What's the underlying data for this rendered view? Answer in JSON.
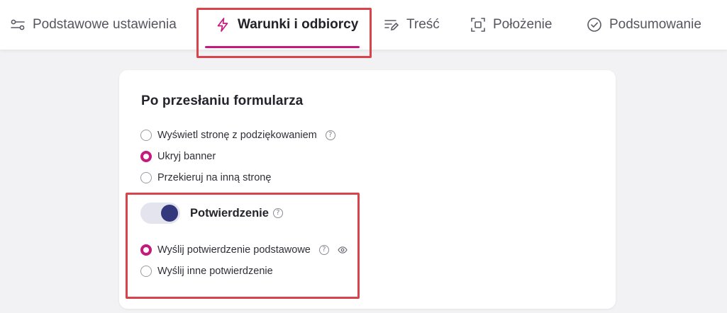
{
  "tabs": [
    {
      "label": "Podstawowe ustawienia",
      "icon": "sliders-icon",
      "active": false
    },
    {
      "label": "Warunki i odbiorcy",
      "icon": "lightning-icon",
      "active": true
    },
    {
      "label": "Treść",
      "icon": "text-edit-icon",
      "active": false
    },
    {
      "label": "Położenie",
      "icon": "frame-position-icon",
      "active": false
    },
    {
      "label": "Podsumowanie",
      "icon": "check-circle-icon",
      "active": false
    }
  ],
  "card": {
    "title": "Po przesłaniu formularza",
    "options": [
      {
        "label": "Wyświetl stronę z podziękowaniem",
        "checked": false,
        "help": true
      },
      {
        "label": "Ukryj banner",
        "checked": true,
        "help": false
      },
      {
        "label": "Przekieruj na inną stronę",
        "checked": false,
        "help": false
      }
    ],
    "confirmation": {
      "label": "Potwierdzenie",
      "enabled": true,
      "options": [
        {
          "label": "Wyślij potwierdzenie podstawowe",
          "checked": true,
          "help": true,
          "preview": true
        },
        {
          "label": "Wyślij inne potwierdzenie",
          "checked": false,
          "help": false,
          "preview": false
        }
      ]
    }
  },
  "help_glyph": "?",
  "colors": {
    "accent": "#c6197e",
    "toggle_knob": "#33387c",
    "highlight": "#d9434b"
  }
}
